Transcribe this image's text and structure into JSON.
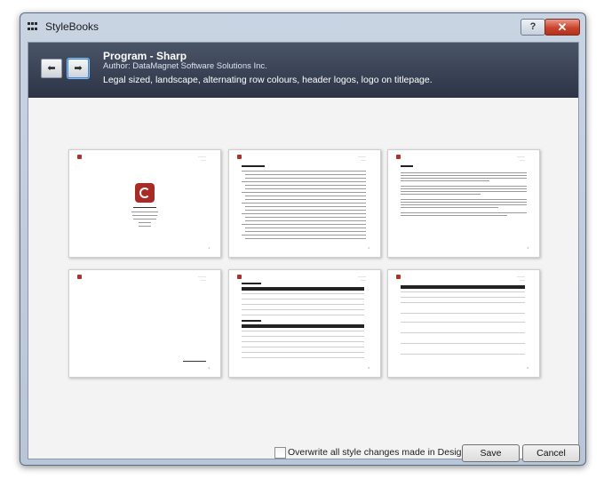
{
  "window": {
    "title": "StyleBooks",
    "help_glyph": "?",
    "close_glyph": "✕"
  },
  "nav": {
    "back_icon": "arrow-left-icon",
    "forward_icon": "arrow-right-icon",
    "back_glyph": "⬅",
    "forward_glyph": "➡"
  },
  "stylebook": {
    "name": "Program - Sharp",
    "author": "Author: DataMagnet Software Solutions Inc.",
    "description": "Legal sized, landscape, alternating row colours, header logos, logo on titlepage."
  },
  "footer": {
    "overwrite_label": "Overwrite all style changes made in Designer",
    "save_label": "Save",
    "cancel_label": "Cancel"
  },
  "colors": {
    "header_dark": "#2c3446",
    "logo_red": "#a92b25",
    "close_red": "#c8442c"
  }
}
